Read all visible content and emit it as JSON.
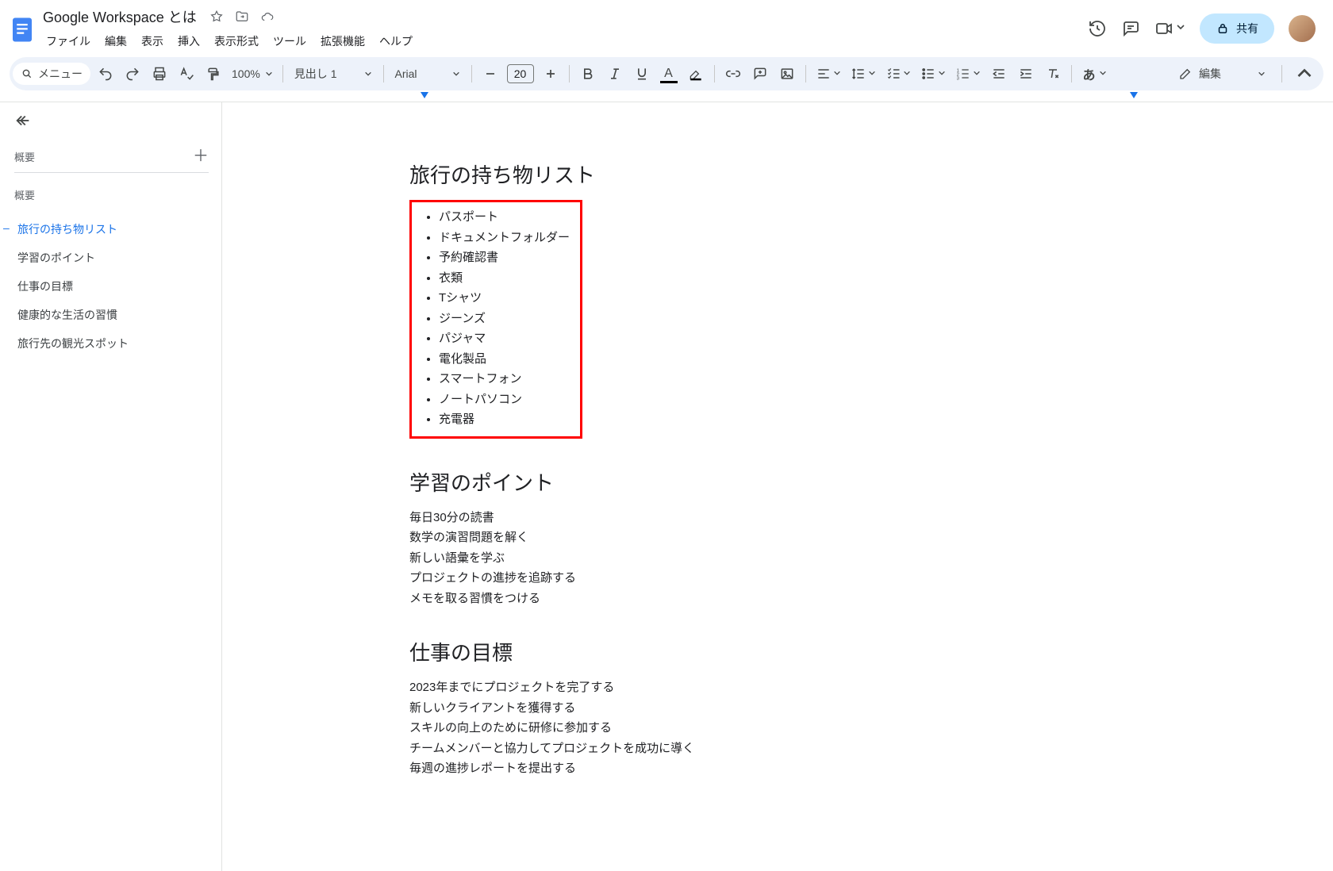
{
  "header": {
    "doc_title": "Google Workspace とは",
    "menus": [
      "ファイル",
      "編集",
      "表示",
      "挿入",
      "表示形式",
      "ツール",
      "拡張機能",
      "ヘルプ"
    ],
    "share_label": "共有"
  },
  "toolbar": {
    "menu_label": "メニュー",
    "zoom": "100%",
    "style": "見出し 1",
    "font": "Arial",
    "font_size": "20",
    "ime": "あ",
    "mode_label": "編集"
  },
  "outline": {
    "summary_label": "概要",
    "summary2": "概要",
    "items": [
      {
        "label": "旅行の持ち物リスト",
        "active": true
      },
      {
        "label": "学習のポイント",
        "active": false
      },
      {
        "label": "仕事の目標",
        "active": false
      },
      {
        "label": "健康的な生活の習慣",
        "active": false
      },
      {
        "label": "旅行先の観光スポット",
        "active": false
      }
    ]
  },
  "doc": {
    "sec1_title": "旅行の持ち物リスト",
    "sec1_items": [
      "パスポート",
      "ドキュメントフォルダー",
      "予約確認書",
      "衣類",
      "Tシャツ",
      "ジーンズ",
      "パジャマ",
      "電化製品",
      "スマートフォン",
      "ノートパソコン",
      "充電器"
    ],
    "sec2_title": "学習のポイント",
    "sec2_items": [
      "毎日30分の読書",
      "数学の演習問題を解く",
      "新しい語彙を学ぶ",
      "プロジェクトの進捗を追跡する",
      "メモを取る習慣をつける"
    ],
    "sec3_title": "仕事の目標",
    "sec3_items": [
      "2023年までにプロジェクトを完了する",
      "新しいクライアントを獲得する",
      "スキルの向上のために研修に参加する",
      "チームメンバーと協力してプロジェクトを成功に導く",
      "毎週の進捗レポートを提出する"
    ]
  }
}
